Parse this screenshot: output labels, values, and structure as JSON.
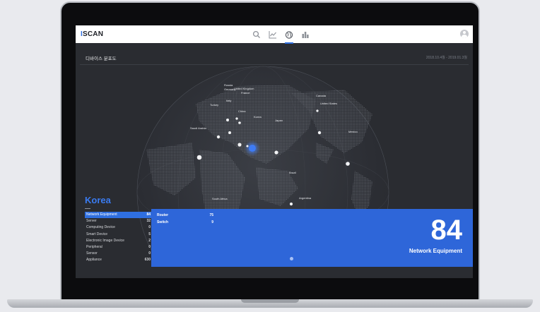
{
  "app": {
    "logo_prefix": "I",
    "logo_text": "SCAN"
  },
  "nav": {
    "icons": [
      "search-icon",
      "line-chart-icon",
      "globe-icon",
      "bar-chart-icon"
    ],
    "active": "globe-icon"
  },
  "page": {
    "title": "디바이스 분포도",
    "date_range": "2018.10.4월 - 2019.01.3월"
  },
  "map": {
    "markers": [
      {
        "label": "Russia"
      },
      {
        "label": "Germany"
      },
      {
        "label": "United Kingdom"
      },
      {
        "label": "France"
      },
      {
        "label": "Italy"
      },
      {
        "label": "Turkey"
      },
      {
        "label": "China"
      },
      {
        "label": "Korea"
      },
      {
        "label": "Japan"
      },
      {
        "label": "Canada"
      },
      {
        "label": "United States"
      },
      {
        "label": "Mexico"
      },
      {
        "label": "Brazil"
      },
      {
        "label": "Argentina"
      },
      {
        "label": "South Africa"
      },
      {
        "label": "Saudi Arabia"
      }
    ]
  },
  "panel": {
    "country": "Korea",
    "categories": [
      {
        "name": "Network Equipment",
        "value": "84"
      },
      {
        "name": "Server",
        "value": "32"
      },
      {
        "name": "Computing Device",
        "value": "0"
      },
      {
        "name": "Smart Device",
        "value": "5"
      },
      {
        "name": "Electronic Image Device",
        "value": "2"
      },
      {
        "name": "Peripheral",
        "value": "0"
      },
      {
        "name": "Sensor",
        "value": "0"
      },
      {
        "name": "Appliance",
        "value": "630"
      }
    ],
    "selected_index": 0
  },
  "detail": {
    "items": [
      {
        "name": "Router",
        "value": "75"
      },
      {
        "name": "Switch",
        "value": "9"
      }
    ],
    "count": "84",
    "label": "Network Equipment"
  },
  "colors": {
    "accent": "#2f6fe0",
    "panel": "#2e66d9",
    "screen_bg": "#2a2c31"
  }
}
